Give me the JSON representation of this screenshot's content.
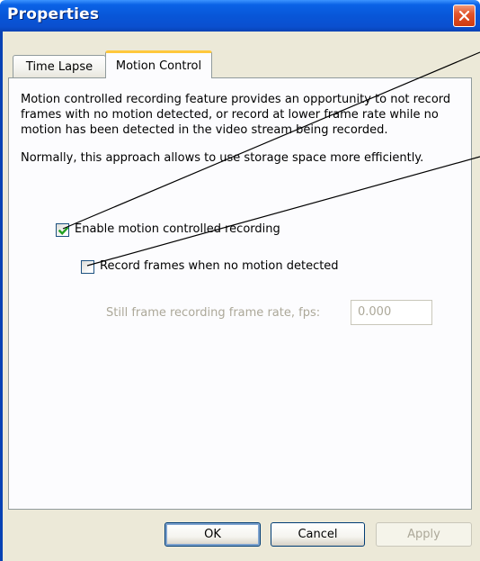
{
  "window": {
    "title": "Properties",
    "close_icon": "close-icon"
  },
  "tabs": [
    {
      "label": "Time Lapse",
      "active": false
    },
    {
      "label": "Motion Control",
      "active": true
    }
  ],
  "panel": {
    "description_1": "Motion controlled recording feature provides an opportunity to not record frames with no motion detected, or record at lower frame rate while no motion has been detected in the video stream being recorded.",
    "description_2": "Normally, this approach allows to use storage space more efficiently.",
    "enable_motion": {
      "label": "Enable motion controlled recording",
      "checked": true
    },
    "record_no_motion": {
      "label": "Record frames when no motion detected",
      "checked": false
    },
    "frame_rate": {
      "label": "Still frame recording frame rate, fps:",
      "value": "0.000",
      "enabled": false
    }
  },
  "buttons": {
    "ok": "OK",
    "cancel": "Cancel",
    "apply": "Apply"
  },
  "colors": {
    "titlebar": "#0a62e6",
    "face": "#ece9d8",
    "checkmark": "#21a121",
    "tab_highlight": "#ffc83c"
  }
}
